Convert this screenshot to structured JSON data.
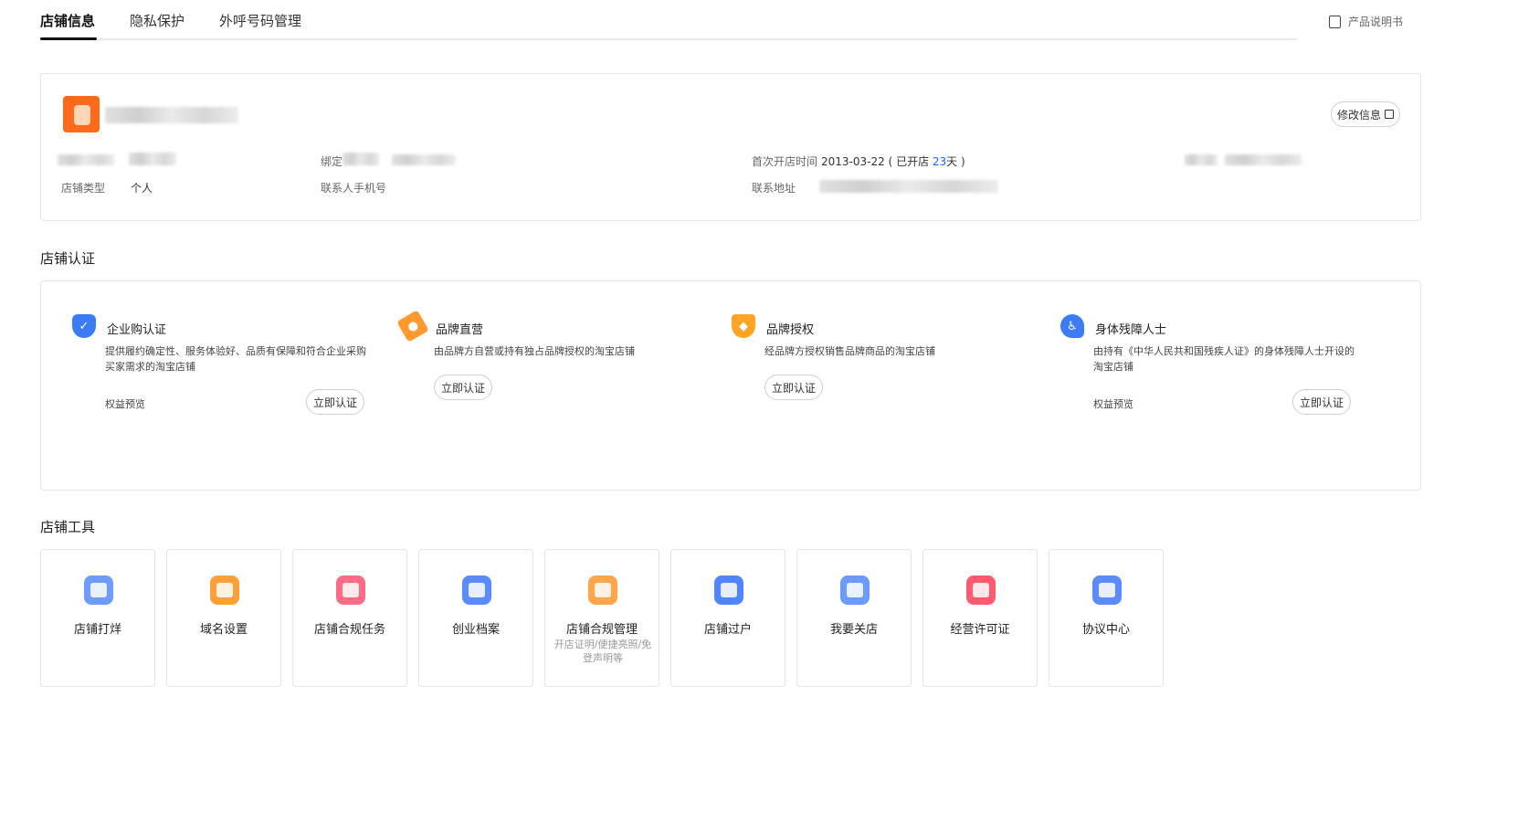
{
  "tabs": [
    {
      "label": "店铺信息",
      "active": true
    },
    {
      "label": "隐私保护",
      "active": false
    },
    {
      "label": "外呼号码管理",
      "active": false
    }
  ],
  "manual_label": "产品说明书",
  "shop_info": {
    "edit_label": "修改信息",
    "bind_label_partial": "绑定",
    "shop_type_label": "店铺类型",
    "shop_type_value": "个人",
    "contact_phone_label": "联系人手机号",
    "first_open_label": "首次开店时间",
    "first_open_date": "2013-03-22",
    "open_prefix": "( 已开店 ",
    "open_days": "23",
    "open_suffix": "天 )",
    "address_label": "联系地址"
  },
  "certification": {
    "title": "店铺认证",
    "items": [
      {
        "name": "企业购认证",
        "desc": "提供履约确定性、服务体验好、品质有保障和符合企业采购买家需求的淘宝店铺",
        "preview": "权益预览",
        "button": "立即认证",
        "color": "#3b7cf6",
        "icon": "shield-check-icon"
      },
      {
        "name": "品牌直营",
        "desc": "由品牌方自营或持有独占品牌授权的淘宝店铺",
        "preview": "",
        "button": "立即认证",
        "color": "#ff9a2e",
        "icon": "tag-icon"
      },
      {
        "name": "品牌授权",
        "desc": "经品牌方授权销售品牌商品的淘宝店铺",
        "preview": "",
        "button": "立即认证",
        "color": "#ffa425",
        "icon": "diamond-icon"
      },
      {
        "name": "身体残障人士",
        "desc": "由持有《中华人民共和国残疾人证》的身体残障人士开设的淘宝店铺",
        "preview": "权益预览",
        "button": "立即认证",
        "color": "#3b7cf6",
        "icon": "accessibility-heart-icon"
      }
    ]
  },
  "tools": {
    "title": "店铺工具",
    "items": [
      {
        "label": "店铺打烊",
        "sub": "",
        "color": "#6f9bff",
        "icon": "shop-close-icon"
      },
      {
        "label": "域名设置",
        "sub": "",
        "color": "#ff9f3a",
        "icon": "domain-icon"
      },
      {
        "label": "店铺合规任务",
        "sub": "",
        "color": "#ff6b86",
        "icon": "compliance-shield-icon"
      },
      {
        "label": "创业档案",
        "sub": "",
        "color": "#5b8cff",
        "icon": "archive-icon"
      },
      {
        "label": "店铺合规管理",
        "sub": "开店证明/便捷亮照/免登声明等",
        "color": "#ffa64a",
        "icon": "compliance-doc-icon"
      },
      {
        "label": "店铺过户",
        "sub": "",
        "color": "#4f86ff",
        "icon": "transfer-icon"
      },
      {
        "label": "我要关店",
        "sub": "",
        "color": "#6b9bff",
        "icon": "card-icon"
      },
      {
        "label": "经营许可证",
        "sub": "",
        "color": "#ff5a6e",
        "icon": "license-folder-icon"
      },
      {
        "label": "协议中心",
        "sub": "",
        "color": "#5b8cff",
        "icon": "agreement-icon"
      }
    ]
  }
}
